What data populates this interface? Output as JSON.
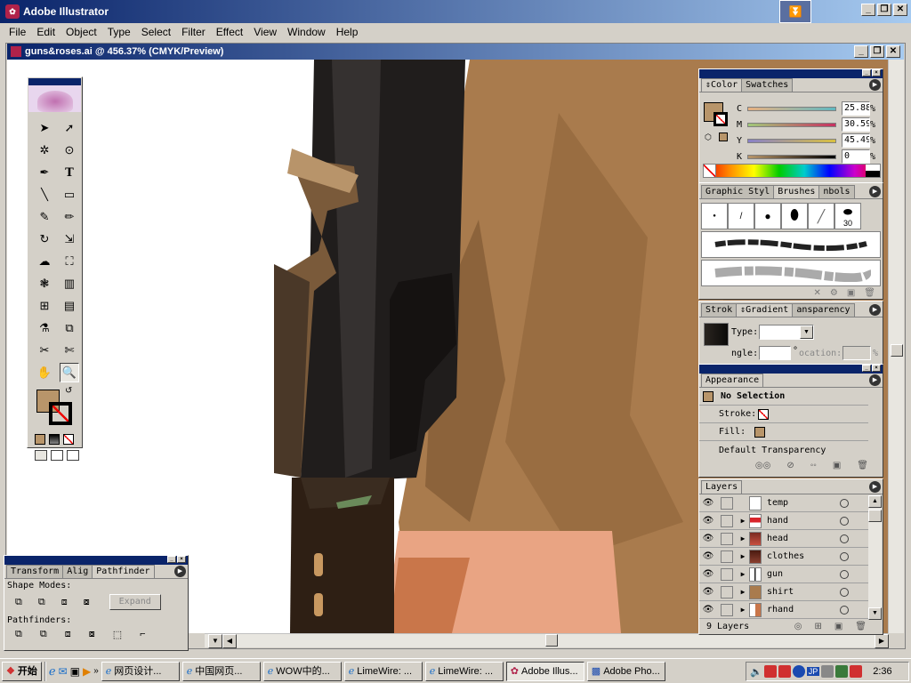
{
  "app": {
    "title": "Adobe Illustrator"
  },
  "menu": [
    "File",
    "Edit",
    "Object",
    "Type",
    "Select",
    "Filter",
    "Effect",
    "View",
    "Window",
    "Help"
  ],
  "document": {
    "title": "guns&roses.ai @ 456.37% (CMYK/Preview)"
  },
  "color_panel": {
    "tabs": [
      "Color",
      "Swatches"
    ],
    "channels": [
      {
        "label": "C",
        "value": "25.88"
      },
      {
        "label": "M",
        "value": "30.59"
      },
      {
        "label": "Y",
        "value": "45.49"
      },
      {
        "label": "K",
        "value": "0"
      }
    ],
    "unit": "%",
    "fill_color": "#b8956a"
  },
  "brushes_panel": {
    "tabs": [
      "Graphic Styl",
      "Brushes",
      "nbols"
    ],
    "size_label": "30"
  },
  "gradient_panel": {
    "tabs": [
      "Strok",
      "Gradient",
      "ansparency"
    ],
    "type_label": "Type:",
    "angle_label": "ngle:",
    "location_label": "ocation:",
    "percent": "%",
    "degree": "°"
  },
  "appearance_panel": {
    "tab": "Appearance",
    "selection": "No Selection",
    "stroke_label": "Stroke:",
    "fill_label": "Fill:",
    "transparency": "Default Transparency"
  },
  "layers_panel": {
    "tab": "Layers",
    "layers": [
      {
        "name": "temp",
        "expandable": false
      },
      {
        "name": "hand",
        "expandable": true
      },
      {
        "name": "head",
        "expandable": true
      },
      {
        "name": "clothes",
        "expandable": true
      },
      {
        "name": "gun",
        "expandable": true
      },
      {
        "name": "shirt",
        "expandable": true
      },
      {
        "name": "rhand",
        "expandable": true
      }
    ],
    "count": "9 Layers"
  },
  "pathfinder_panel": {
    "tabs": [
      "Transform",
      "Alig",
      "Pathfinder"
    ],
    "shape_modes_label": "Shape Modes:",
    "expand_label": "Expand",
    "pathfinders_label": "Pathfinders:"
  },
  "taskbar": {
    "start": "开始",
    "items": [
      {
        "label": "网页设计...",
        "active": false
      },
      {
        "label": "中国网页...",
        "active": false
      },
      {
        "label": "WOW中的...",
        "active": false
      },
      {
        "label": "LimeWire: ...",
        "active": false
      },
      {
        "label": "LimeWire: ...",
        "active": false
      },
      {
        "label": "Adobe Illus...",
        "active": true
      },
      {
        "label": "Adobe Pho...",
        "active": false
      }
    ],
    "ime": "JP",
    "clock": "2:36"
  }
}
